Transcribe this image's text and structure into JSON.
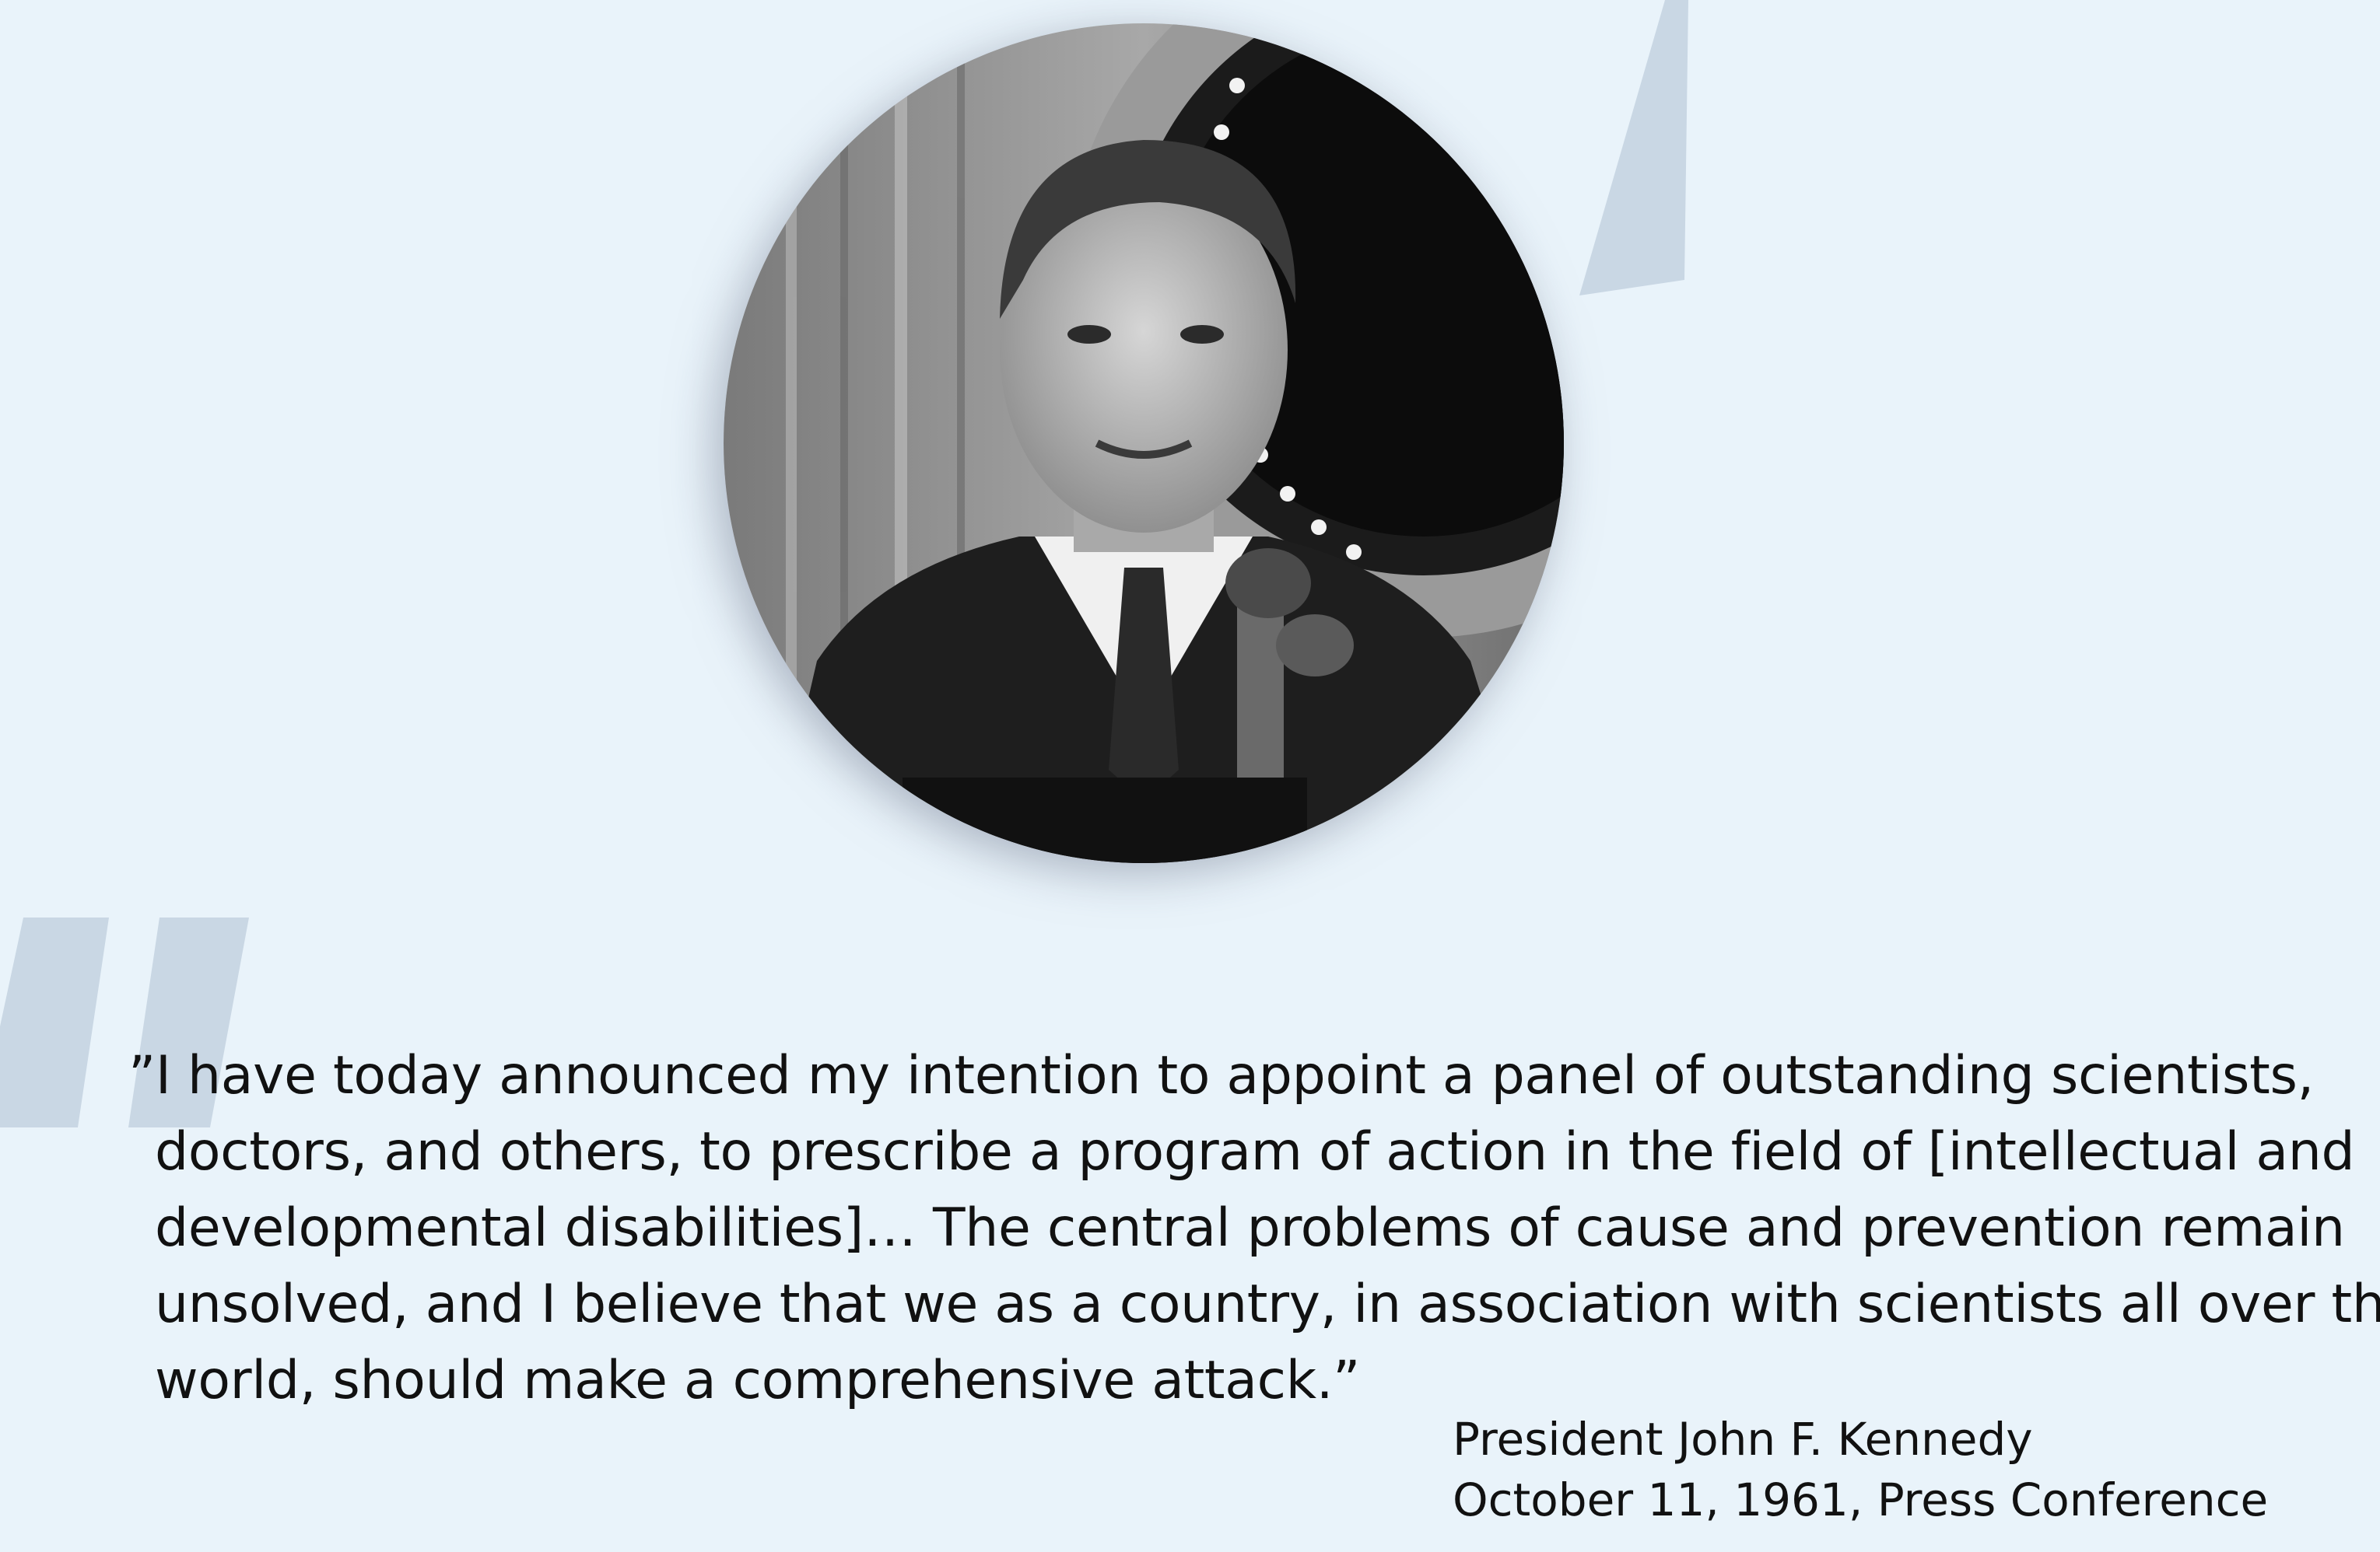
{
  "quote": {
    "lines": [
      "”I have today announced my intention to appoint a panel of outstanding scientists,",
      "doctors, and others, to prescribe a program of action in the field of [intellectual and",
      "developmental disabilities]… The central problems of cause and prevention remain",
      "unsolved, and I believe that we as a country, in association with scientists all over the",
      "world, should make a comprehensive attack.”"
    ]
  },
  "attribution": {
    "name": "President John F. Kennedy",
    "date_event": "October 11, 1961, Press Conference"
  },
  "portrait": {
    "subject": "photo-portrait",
    "style": "black-and-white"
  },
  "colors": {
    "background": "#e9f3fa",
    "quote_mark": "#c9d7e4",
    "text": "#111111"
  }
}
